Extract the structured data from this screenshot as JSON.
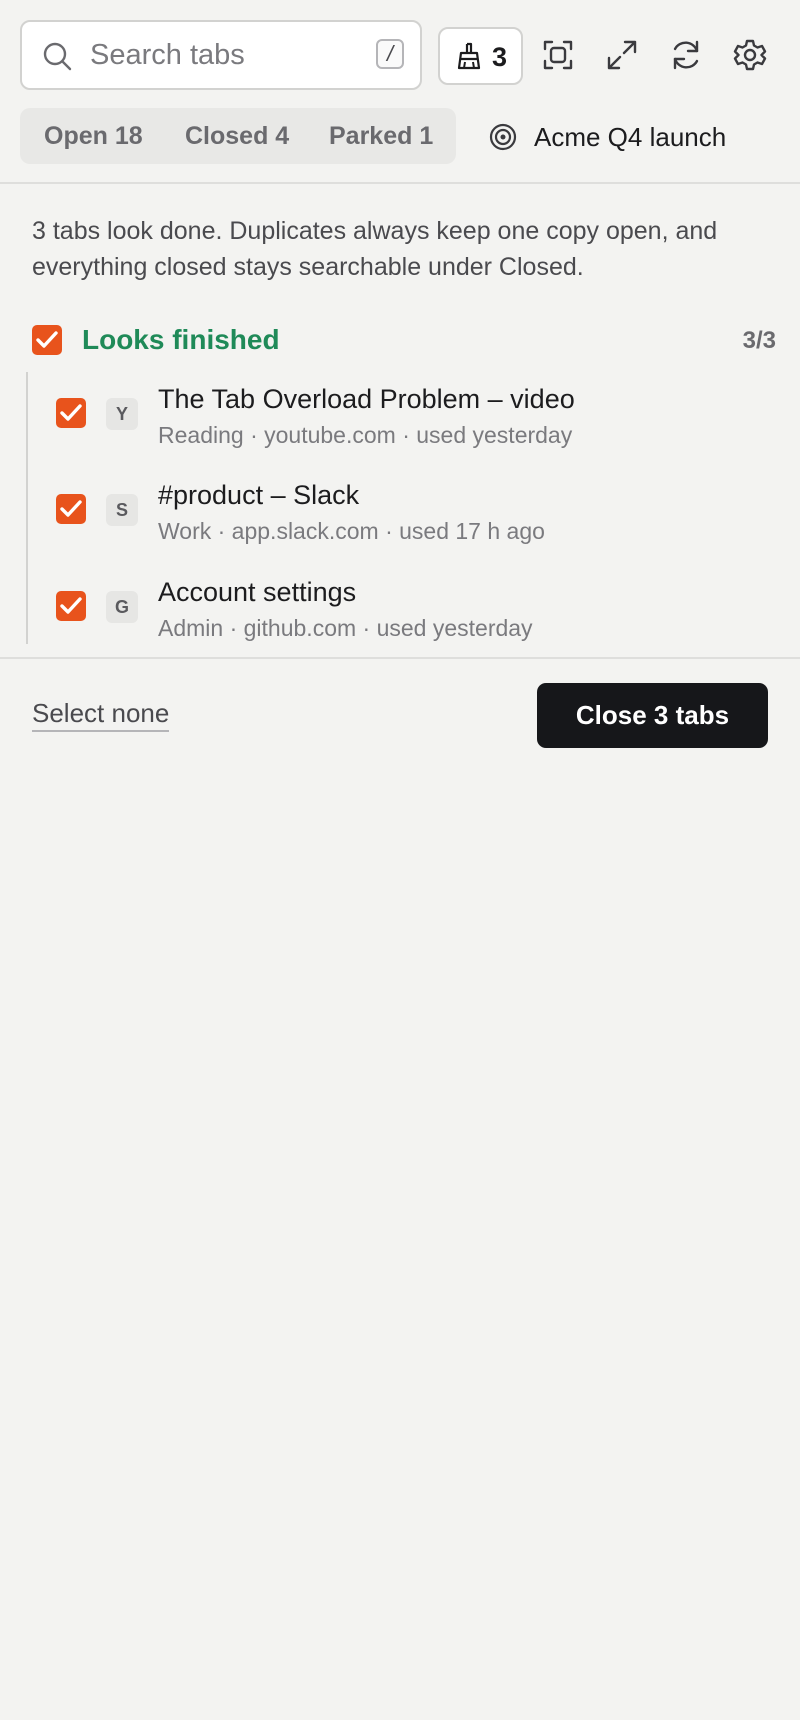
{
  "search": {
    "placeholder": "Search tabs",
    "shortcut": "/"
  },
  "toolbar": {
    "sweep_count": "3",
    "icons": [
      "broom-icon",
      "focus-scan-icon",
      "expand-icon",
      "refresh-icon",
      "gear-icon"
    ]
  },
  "tabs": [
    {
      "label": "Open 18"
    },
    {
      "label": "Closed 4"
    },
    {
      "label": "Parked 1"
    }
  ],
  "workspace": {
    "label": "Acme Q4 launch",
    "icon": "target-icon"
  },
  "intro": "3 tabs look done. Duplicates always keep one copy open, and everything closed stays searchable under Closed.",
  "group": {
    "title": "Looks finished",
    "count": "3/3",
    "checked": true,
    "items": [
      {
        "favicon_letter": "Y",
        "title": "The Tab Overload Problem – video",
        "meta": "Reading · youtube.com · used yesterday",
        "checked": true
      },
      {
        "favicon_letter": "S",
        "title": "#product – Slack",
        "meta": "Work · app.slack.com · used 17 h ago",
        "checked": true
      },
      {
        "favicon_letter": "G",
        "title": "Account settings",
        "meta": "Admin · github.com · used yesterday",
        "checked": true
      }
    ]
  },
  "footer": {
    "select_none": "Select none",
    "close_button": "Close 3 tabs"
  },
  "colors": {
    "accent_checkbox": "#e8531c",
    "group_title": "#1f8a58",
    "primary_button": "#16171a",
    "background": "#f3f3f1"
  }
}
